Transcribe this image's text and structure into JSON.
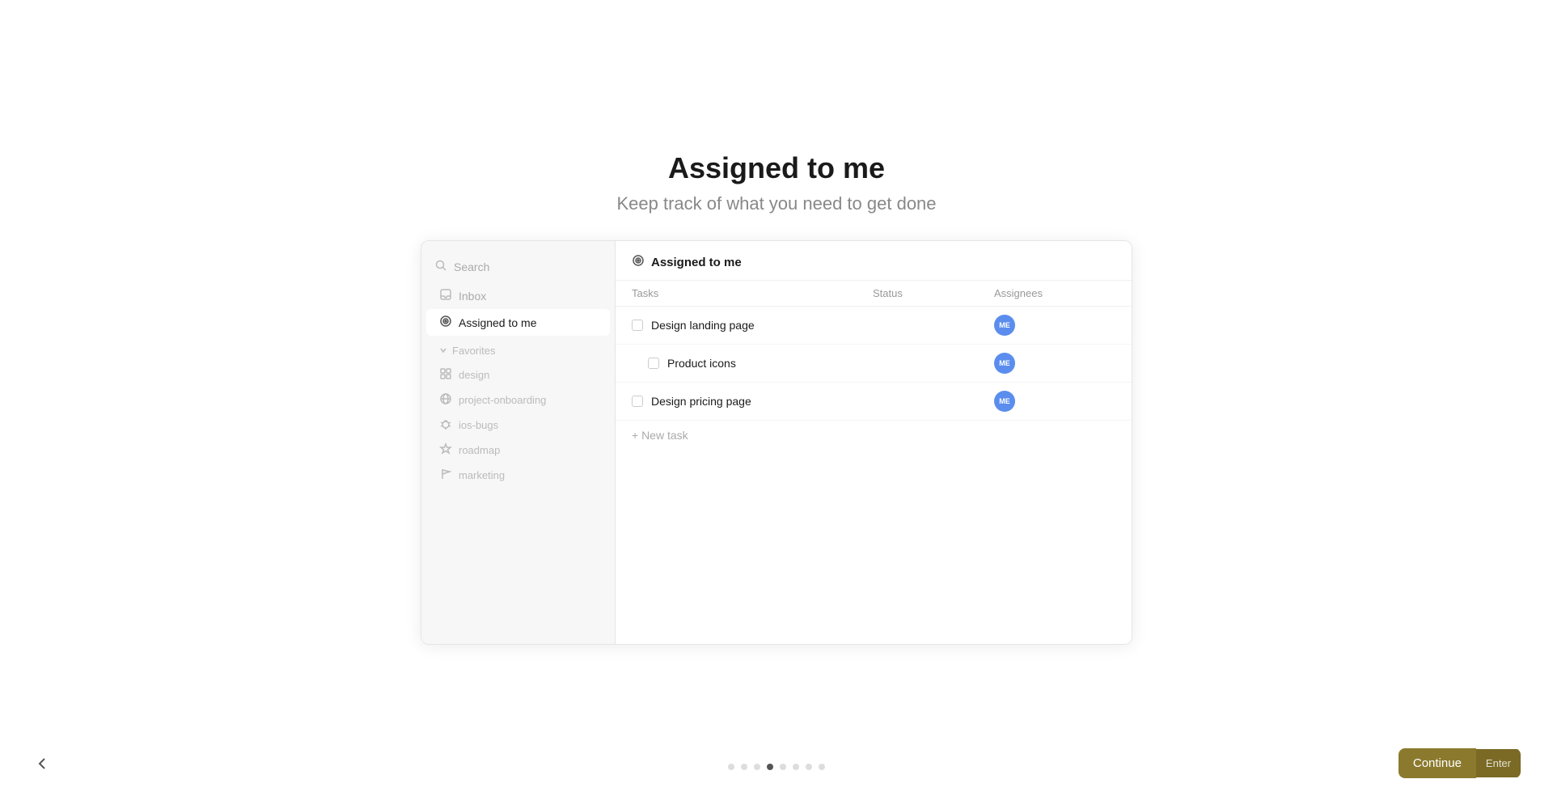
{
  "header": {
    "title": "Assigned to me",
    "subtitle": "Keep track of what you need to get done"
  },
  "sidebar": {
    "search_placeholder": "Search",
    "items": [
      {
        "id": "search",
        "label": "Search",
        "icon": "search-icon",
        "active": false
      },
      {
        "id": "inbox",
        "label": "Inbox",
        "icon": "inbox-icon",
        "active": false
      },
      {
        "id": "assigned",
        "label": "Assigned to me",
        "icon": "target-icon",
        "active": true
      }
    ],
    "favorites_label": "Favorites",
    "projects": [
      {
        "id": "design",
        "label": "design",
        "icon": "grid-icon"
      },
      {
        "id": "project-onboarding",
        "label": "project-onboarding",
        "icon": "globe-icon"
      },
      {
        "id": "ios-bugs",
        "label": "ios-bugs",
        "icon": "bug-icon"
      },
      {
        "id": "roadmap",
        "label": "roadmap",
        "icon": "star-icon"
      },
      {
        "id": "marketing",
        "label": "marketing",
        "icon": "flag-icon"
      }
    ]
  },
  "content": {
    "header": "Assigned to me",
    "columns": {
      "tasks": "Tasks",
      "status": "Status",
      "assignees": "Assignees"
    },
    "tasks": [
      {
        "id": 1,
        "name": "Design landing page",
        "status": "",
        "assignee": "ME",
        "indented": false
      },
      {
        "id": 2,
        "name": "Product icons",
        "status": "",
        "assignee": "ME",
        "indented": true
      },
      {
        "id": 3,
        "name": "Design pricing page",
        "status": "",
        "assignee": "ME",
        "indented": false
      }
    ],
    "new_task_label": "+ New task"
  },
  "pagination": {
    "dots": [
      false,
      false,
      false,
      true,
      false,
      false,
      false,
      false
    ],
    "active_index": 3
  },
  "buttons": {
    "continue_label": "Continue",
    "continue_key": "Enter"
  },
  "colors": {
    "avatar_bg": "#5b8dee",
    "continue_bg": "#8b7a2e",
    "continue_key_bg": "#7a6a25"
  }
}
